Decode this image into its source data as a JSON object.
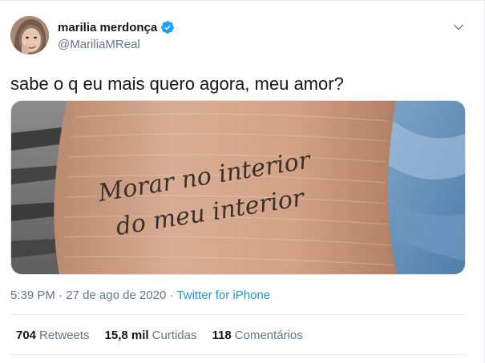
{
  "author": {
    "display_name": "marilia merdonça",
    "handle": "@MariliaMReal",
    "verified_color": "#1da1f2"
  },
  "tweet": {
    "text": "sabe o q eu mais quero agora, meu amor?",
    "media_text_line1": "Morar no interior",
    "media_text_line2": "do meu interior"
  },
  "meta": {
    "time": "5:39 PM",
    "separator": "·",
    "date": "27 de ago de 2020",
    "source": "Twitter for iPhone"
  },
  "stats": {
    "retweets_count": "704",
    "retweets_label": "Retweets",
    "likes_count": "15,8 mil",
    "likes_label": "Curtidas",
    "replies_count": "118",
    "replies_label": "Comentários"
  },
  "icons": {
    "verified": "verified-badge-icon",
    "menu": "chevron-down-icon"
  },
  "colors": {
    "link": "#1b95e0",
    "secondary_text": "#657786",
    "primary_text": "#14171a"
  }
}
